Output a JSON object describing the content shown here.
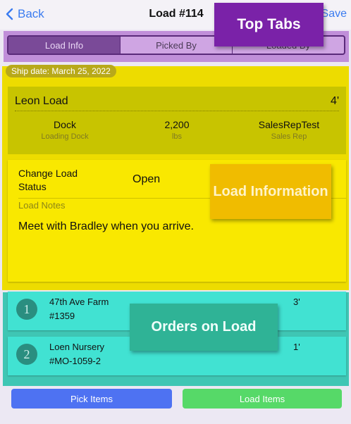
{
  "nav": {
    "back_label": "Back",
    "title": "Load #114",
    "save_label": "Save"
  },
  "tabs": [
    {
      "label": "Load Info",
      "active": true
    },
    {
      "label": "Picked By",
      "active": false
    },
    {
      "label": "Loaded By",
      "active": false
    }
  ],
  "annotations": {
    "top_tabs": "Top Tabs",
    "load_information": "Load Information",
    "orders_on_load": "Orders on Load"
  },
  "load": {
    "ship_date": "Ship date: March 25, 2022",
    "name": "Leon Load",
    "size": "4'",
    "dock": {
      "value": "Dock",
      "label": "Loading Dock"
    },
    "weight": {
      "value": "2,200",
      "label": "lbs"
    },
    "sales_rep": {
      "value": "SalesRepTest",
      "label": "Sales Rep"
    },
    "change_status_label": "Change Load Status",
    "status": "Open",
    "notes_label": "Load Notes",
    "notes": "Meet with Bradley when you arrive."
  },
  "orders": [
    {
      "index": "1",
      "name": "47th Ave Farm",
      "number": "#1359",
      "size": "3'"
    },
    {
      "index": "2",
      "name": "Loen Nursery",
      "number": "#MO-1059-2",
      "size": "1'"
    }
  ],
  "actions": {
    "pick_label": "Pick Items",
    "load_label": "Load Items"
  },
  "colors": {
    "accent_blue": "#3a7bf0",
    "tabs_highlight": "#c08fd9",
    "load_highlight": "#eddc00",
    "orders_highlight": "#3fc6b4",
    "pick_button": "#4e72f2",
    "load_button": "#56d968"
  },
  "icons": {
    "back": "chevron-left-icon"
  }
}
